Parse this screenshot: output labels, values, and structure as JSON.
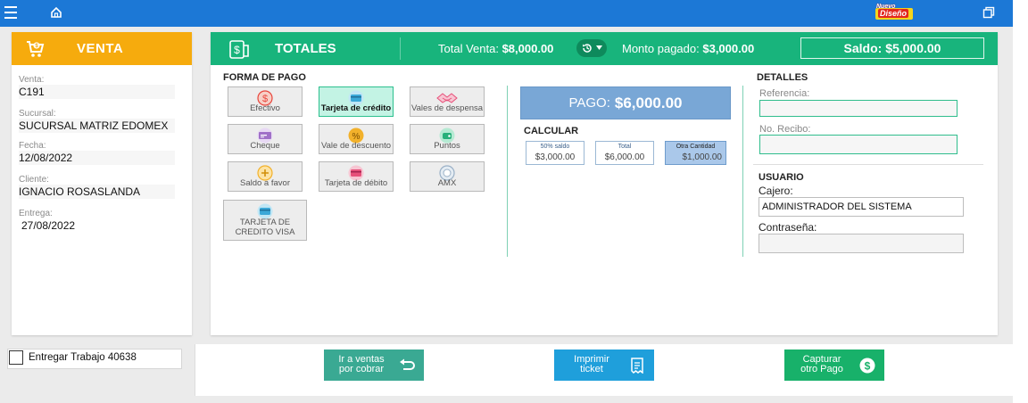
{
  "topbar": {
    "badge_top": "Nuevo",
    "badge_bottom": "Diseño"
  },
  "venta": {
    "title": "VENTA",
    "fields": [
      {
        "label": "Venta:",
        "value": "C191"
      },
      {
        "label": "Sucursal:",
        "value": "SUCURSAL MATRIZ EDOMEX"
      },
      {
        "label": "Fecha:",
        "value": "12/08/2022"
      },
      {
        "label": "Cliente:",
        "value": "IGNACIO ROSASLANDA"
      },
      {
        "label": "Entrega:",
        "value": "27/08/2022"
      }
    ]
  },
  "totales": {
    "title": "TOTALES",
    "total_venta_label": "Total Venta:",
    "total_venta_value": "$8,000.00",
    "monto_pagado_label": "Monto pagado:",
    "monto_pagado_value": "$3,000.00",
    "saldo_label": "Saldo:",
    "saldo_value": "$5,000.00"
  },
  "forma_pago": {
    "title": "FORMA DE PAGO",
    "methods": [
      {
        "label": "Efectivo",
        "icon": "dollar-coin-icon",
        "color": "#e8453c"
      },
      {
        "label": "Tarjeta de crédito",
        "icon": "credit-card-icon",
        "color": "#3aa8d8"
      },
      {
        "label": "Vales de despensa",
        "icon": "handshake-icon",
        "color": "#e7507a"
      },
      {
        "label": "Cheque",
        "icon": "cheque-icon",
        "color": "#a070c8"
      },
      {
        "label": "Vale de descuento",
        "icon": "percent-icon",
        "color": "#f2b12b"
      },
      {
        "label": "Puntos",
        "icon": "points-icon",
        "color": "#27b07a"
      },
      {
        "label": "Saldo a favor",
        "icon": "plus-coin-icon",
        "color": "#f2b12b"
      },
      {
        "label": "Tarjeta de débito",
        "icon": "debit-card-icon",
        "color": "#e7507a"
      },
      {
        "label": "AMX",
        "icon": "amx-icon",
        "color": "#9ab0c6"
      },
      {
        "label": "TARJETA DE CREDITO VISA",
        "icon": "visa-card-icon",
        "color": "#3aa8d8"
      }
    ],
    "selected": "Tarjeta de crédito"
  },
  "pago": {
    "label": "PAGO:",
    "value": "$6,000.00"
  },
  "calcular": {
    "title": "CALCULAR",
    "options": [
      {
        "label": "50% saldo",
        "value": "$3,000.00"
      },
      {
        "label": "Total",
        "value": "$6,000.00"
      },
      {
        "label": "Otra Cantidad",
        "value": "$1,000.00"
      }
    ]
  },
  "detalles": {
    "title": "DETALLES",
    "referencia_label": "Referencia:",
    "recibo_label": "No. Recibo:"
  },
  "usuario": {
    "title": "USUARIO",
    "cajero_label": "Cajero:",
    "cajero_value": "ADMINISTRADOR DEL SISTEMA",
    "password_label": "Contraseña:"
  },
  "bottom": {
    "entregar_label": "Entregar Trabajo 40638",
    "btn_ventas_line1": "Ir a ventas",
    "btn_ventas_line2": "por cobrar",
    "btn_imprimir_line1": "Imprimir",
    "btn_imprimir_line2": "ticket",
    "btn_capturar_line1": "Capturar",
    "btn_capturar_line2": "otro Pago"
  },
  "colors": {
    "topbar": "#1c78d6",
    "venta_header": "#f6ab0d",
    "totales_header": "#18b47c",
    "pago_box": "#79a7d6",
    "btn_ventas": "#3aa993",
    "btn_imprimir": "#1f9fdb",
    "btn_capturar": "#18b16a"
  }
}
